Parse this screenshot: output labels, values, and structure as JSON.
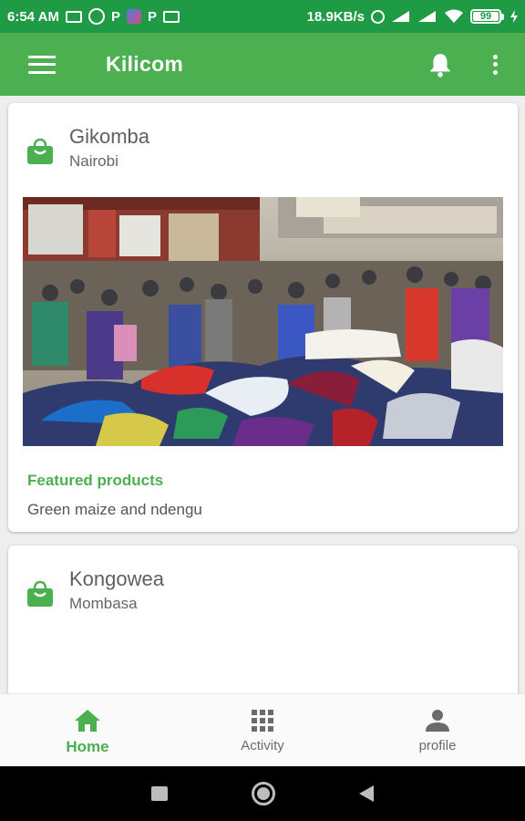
{
  "status_bar": {
    "time": "6:54 AM",
    "notification_icons": [
      "message-icon",
      "whatsapp-icon",
      "p-app-icon",
      "colorful-app-icon",
      "p-app-icon",
      "screen-icon"
    ],
    "p_label": "P",
    "net_speed": "18.9KB/s",
    "battery": "99"
  },
  "app_bar": {
    "title": "Kilicom",
    "menu_icon": "hamburger-menu-icon",
    "bell_icon": "bell-icon",
    "more_icon": "more-vertical-icon"
  },
  "markets": [
    {
      "name": "Gikomba",
      "city": "Nairobi",
      "icon": "shopping-bag-icon",
      "image": "crowded-open-air-clothes-market",
      "featured_label": "Featured products",
      "featured_value": "Green maize and ndengu"
    },
    {
      "name": "Kongowea",
      "city": "Mombasa",
      "icon": "shopping-bag-icon"
    }
  ],
  "bottom_nav": {
    "items": [
      {
        "label": "Home",
        "icon": "home-icon",
        "active": true
      },
      {
        "label": "Activity",
        "icon": "grid-icon",
        "active": false
      },
      {
        "label": "profile",
        "icon": "person-icon",
        "active": false
      }
    ]
  },
  "colors": {
    "status_bar": "#1f9a45",
    "primary": "#4caf50",
    "text_secondary": "#666666"
  }
}
